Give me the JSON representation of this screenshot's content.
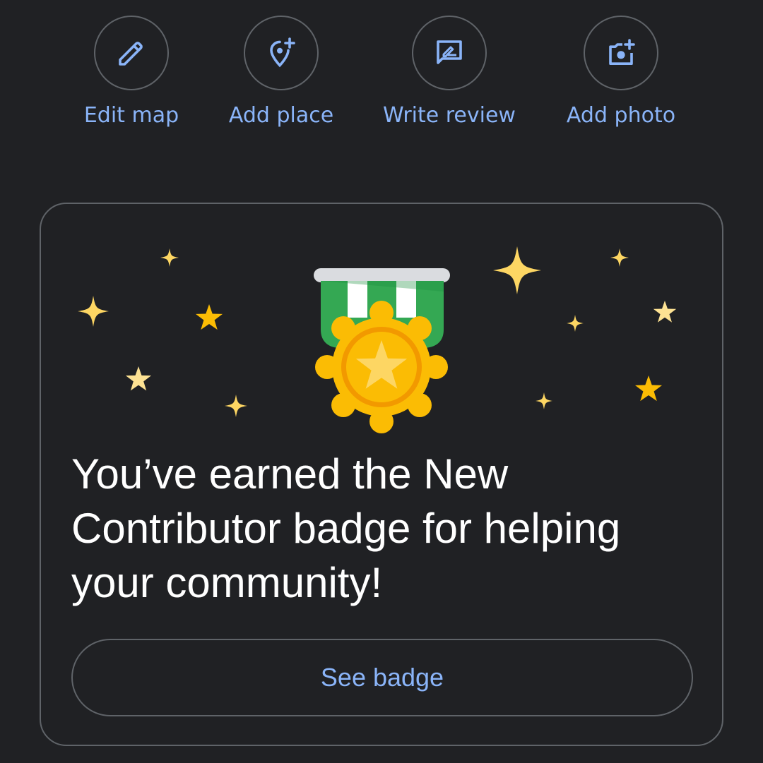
{
  "actions": {
    "edit_map": {
      "label": "Edit map",
      "icon": "pencil-icon"
    },
    "add_place": {
      "label": "Add place",
      "icon": "add-location-icon"
    },
    "write_review": {
      "label": "Write review",
      "icon": "rate-review-icon"
    },
    "add_photo": {
      "label": "Add photo",
      "icon": "add-photo-icon"
    }
  },
  "badge_card": {
    "message": "You’ve earned the New Contributor badge for helping your community!",
    "button_label": "See badge",
    "illustration": "medal-with-sparkles"
  },
  "colors": {
    "background": "#202124",
    "accent": "#8ab4f8",
    "outline": "#5f6368",
    "medal_gold": "#fbbc04",
    "ribbon_green": "#34a853",
    "sparkle_yellow": "#fdd663"
  }
}
